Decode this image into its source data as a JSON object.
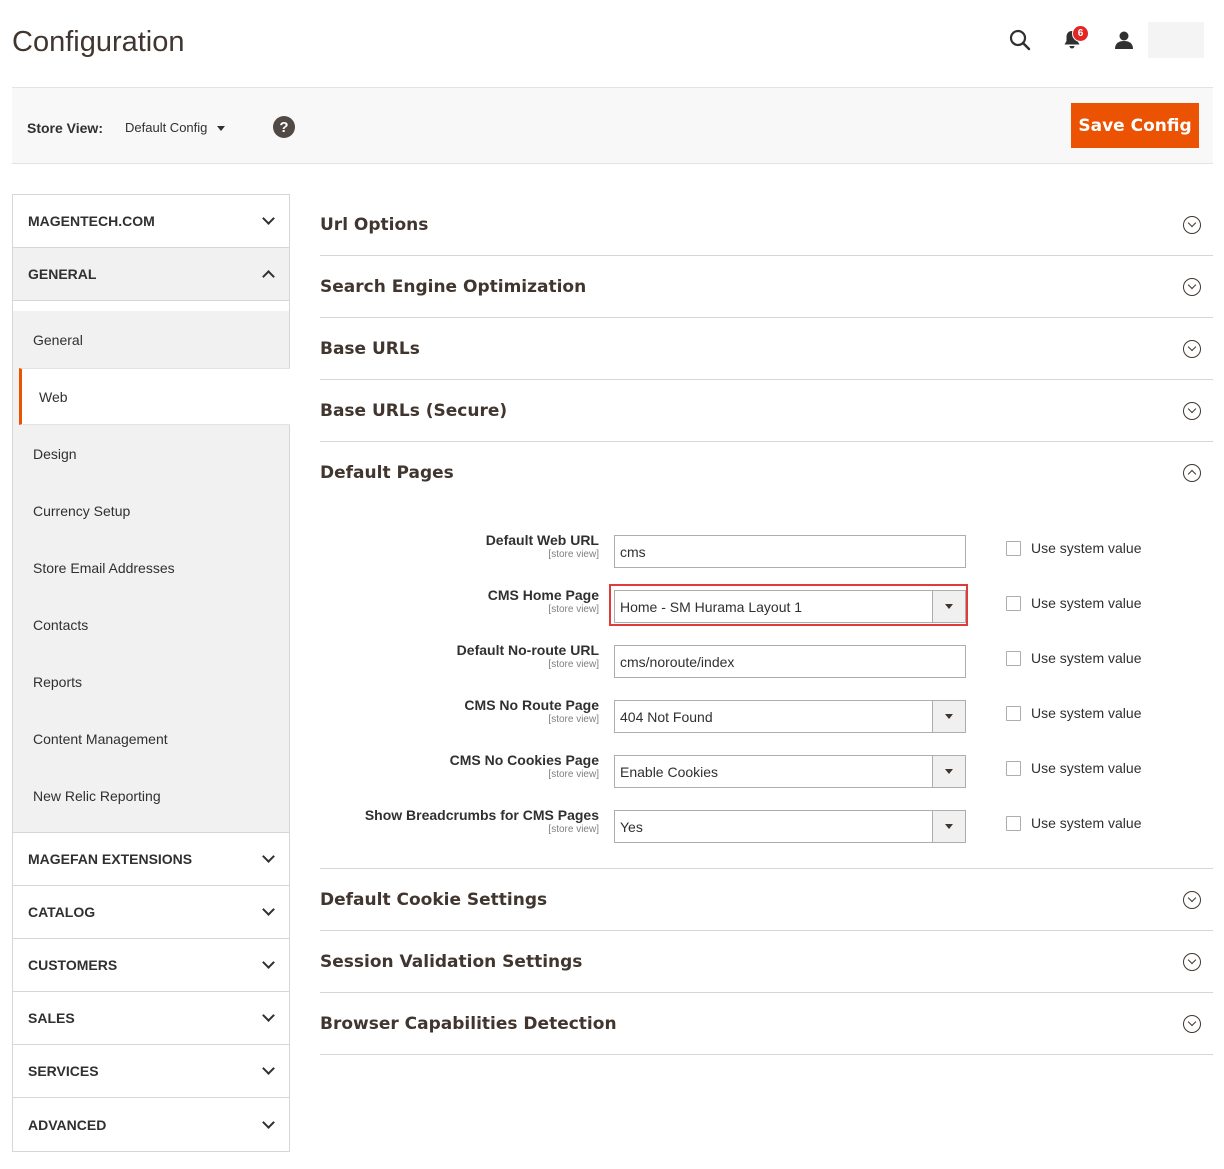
{
  "header": {
    "title": "Configuration",
    "notifications_count": "6"
  },
  "store_bar": {
    "label": "Store View:",
    "selected": "Default Config",
    "help": "?",
    "save_label": "Save Config"
  },
  "sidebar": {
    "sections": [
      {
        "label": "MAGENTECH.COM"
      },
      {
        "label": "GENERAL"
      },
      {
        "label": "MAGEFAN EXTENSIONS"
      },
      {
        "label": "CATALOG"
      },
      {
        "label": "CUSTOMERS"
      },
      {
        "label": "SALES"
      },
      {
        "label": "SERVICES"
      },
      {
        "label": "ADVANCED"
      }
    ],
    "general_items": [
      {
        "label": "General"
      },
      {
        "label": "Web"
      },
      {
        "label": "Design"
      },
      {
        "label": "Currency Setup"
      },
      {
        "label": "Store Email Addresses"
      },
      {
        "label": "Contacts"
      },
      {
        "label": "Reports"
      },
      {
        "label": "Content Management"
      },
      {
        "label": "New Relic Reporting"
      }
    ]
  },
  "main": {
    "sections_before": [
      {
        "label": "Url Options"
      },
      {
        "label": "Search Engine Optimization"
      },
      {
        "label": "Base URLs"
      },
      {
        "label": "Base URLs (Secure)"
      }
    ],
    "open_section": {
      "label": "Default Pages"
    },
    "scope": "[store view]",
    "use_system_value": "Use system value",
    "fields": [
      {
        "label": "Default Web URL",
        "value": "cms"
      },
      {
        "label": "CMS Home Page",
        "value": "Home - SM Hurama Layout 1"
      },
      {
        "label": "Default No-route URL",
        "value": "cms/noroute/index"
      },
      {
        "label": "CMS No Route Page",
        "value": "404 Not Found"
      },
      {
        "label": "CMS No Cookies Page",
        "value": "Enable Cookies"
      },
      {
        "label": "Show Breadcrumbs for CMS Pages",
        "value": "Yes"
      }
    ],
    "sections_after": [
      {
        "label": "Default Cookie Settings"
      },
      {
        "label": "Session Validation Settings"
      },
      {
        "label": "Browser Capabilities Detection"
      }
    ]
  },
  "colors": {
    "accent": "#eb5202",
    "highlight": "#e03a3a",
    "badge": "#e22626"
  }
}
